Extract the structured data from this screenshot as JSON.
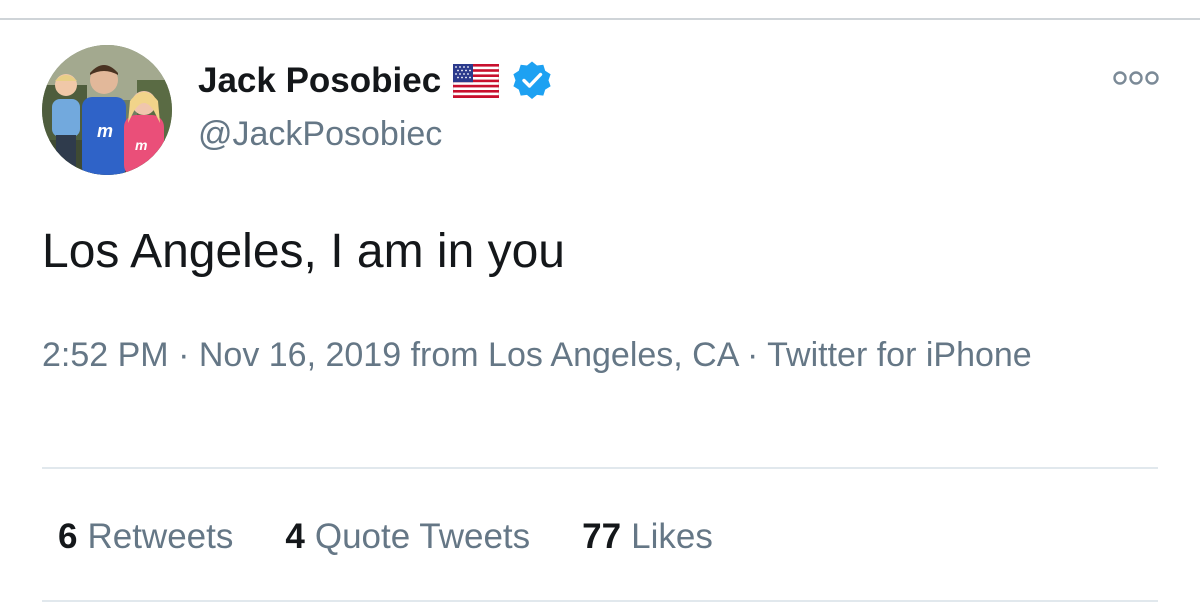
{
  "author": {
    "name": "Jack Posobiec",
    "handle": "@JackPosobiec",
    "badges": [
      "us-flag-icon",
      "verified-badge-icon"
    ]
  },
  "tweet": {
    "text": "Los Angeles, I am in you",
    "time": "2:52 PM",
    "date": "Nov 16, 2019",
    "from_prefix": "from",
    "location": "Los Angeles, CA",
    "source": "Twitter for iPhone"
  },
  "stats": {
    "retweets_count": "6",
    "retweets_label": "Retweets",
    "quotes_count": "4",
    "quotes_label": "Quote Tweets",
    "likes_count": "77",
    "likes_label": "Likes"
  },
  "icons": {
    "more": "more-options-icon"
  },
  "colors": {
    "text": "#14171a",
    "secondary": "#657786",
    "verified": "#1da1f2",
    "divider": "#e1e8ed"
  }
}
